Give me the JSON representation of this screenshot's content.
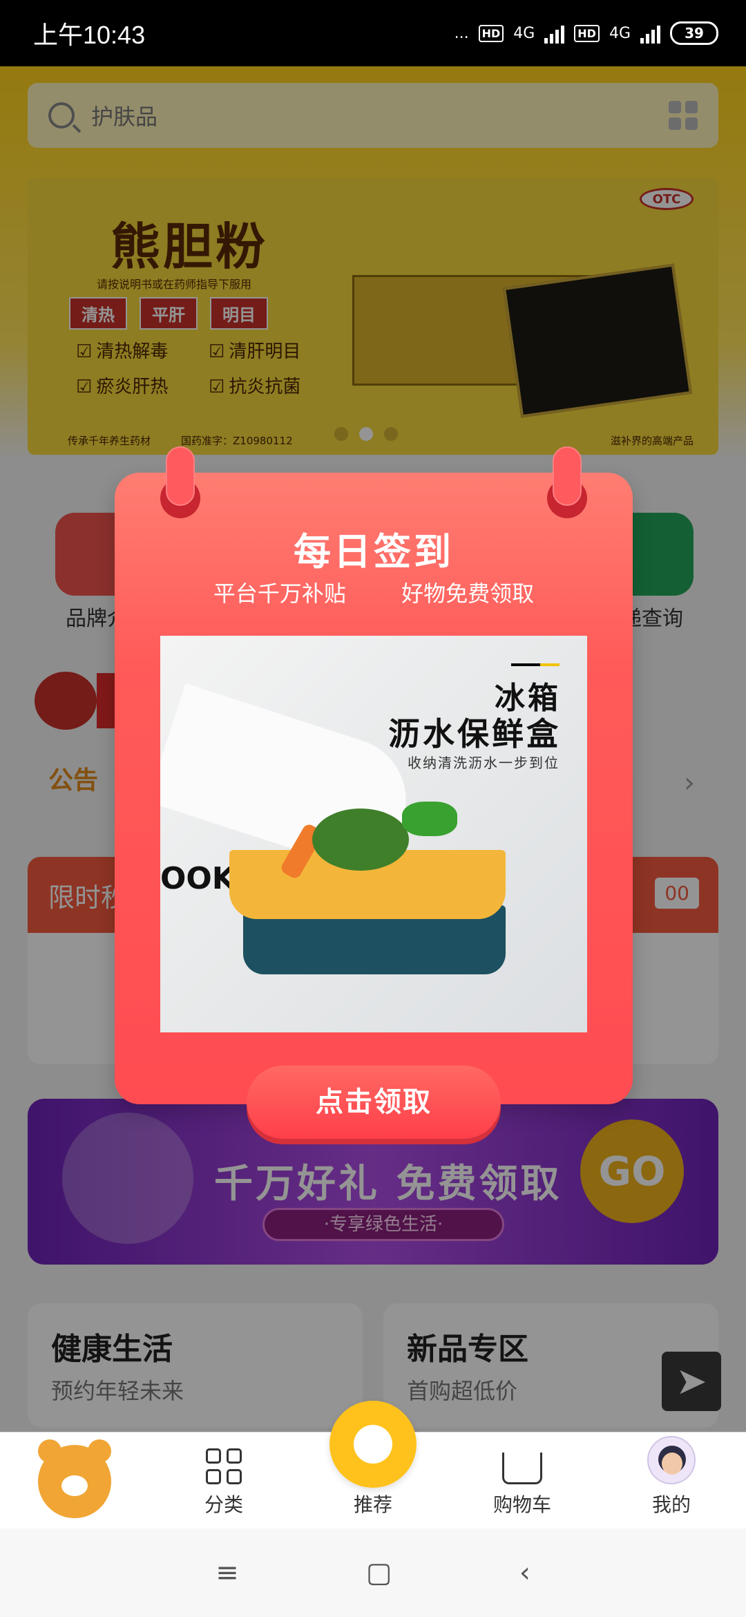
{
  "status_bar": {
    "time": "上午10:43",
    "dots": "...",
    "hd1": "HD",
    "net1": "4G",
    "hd2": "HD",
    "net2": "4G",
    "battery": "39"
  },
  "search": {
    "placeholder": "护肤品"
  },
  "banner": {
    "title": "熊胆粉",
    "subtitle": "请按说明书或在药师指导下服用",
    "tags": [
      "清热",
      "平肝",
      "明目"
    ],
    "checks": [
      "清热解毒",
      "清肝明目",
      "瘀炎肝热",
      "抗炎抗菌"
    ],
    "footer_left": "传承千年养生药材",
    "footer_mid": "国药准字：Z10980112",
    "footer_right": "滋补界的高端产品",
    "otc": "OTC",
    "carousel_active_index": 1,
    "carousel_count": 3
  },
  "quick_menu": {
    "left_label": "品牌介",
    "right_label": "递查询"
  },
  "notice": {
    "label": "公告"
  },
  "flash_sale": {
    "label": "限时秒",
    "countdown": "00"
  },
  "promo": {
    "text": "千万好礼 免费领取",
    "pill": "·专享绿色生活·",
    "go": "GO"
  },
  "cards": [
    {
      "title": "健康生活",
      "subtitle": "预约年轻未来"
    },
    {
      "title": "新品专区",
      "subtitle": "首购超低价"
    }
  ],
  "modal": {
    "title": "每日签到",
    "subtitle_left": "平台千万补贴",
    "subtitle_right": "好物免费领取",
    "product_heading1": "冰箱",
    "product_heading2": "沥水保鲜盒",
    "product_caption": "收纳清洗沥水一步到位",
    "product_cook_text": "OOKI",
    "claim_button": "点击领取"
  },
  "tabbar": {
    "items": [
      {
        "label": "",
        "icon": "bear-logo-icon"
      },
      {
        "label": "分类",
        "icon": "category-grid-icon"
      },
      {
        "label": "推荐",
        "icon": "recommend-icon"
      },
      {
        "label": "购物车",
        "icon": "cart-icon"
      },
      {
        "label": "我的",
        "icon": "avatar-icon"
      }
    ]
  },
  "sysnav": {
    "menu": "≡",
    "home": "▢",
    "back": "‹"
  },
  "colors": {
    "header_yellow": "#ffd21a",
    "modal_red": "#ff5b59",
    "accent_orange": "#e28b1c",
    "recommend_yellow": "#ffc21c"
  }
}
